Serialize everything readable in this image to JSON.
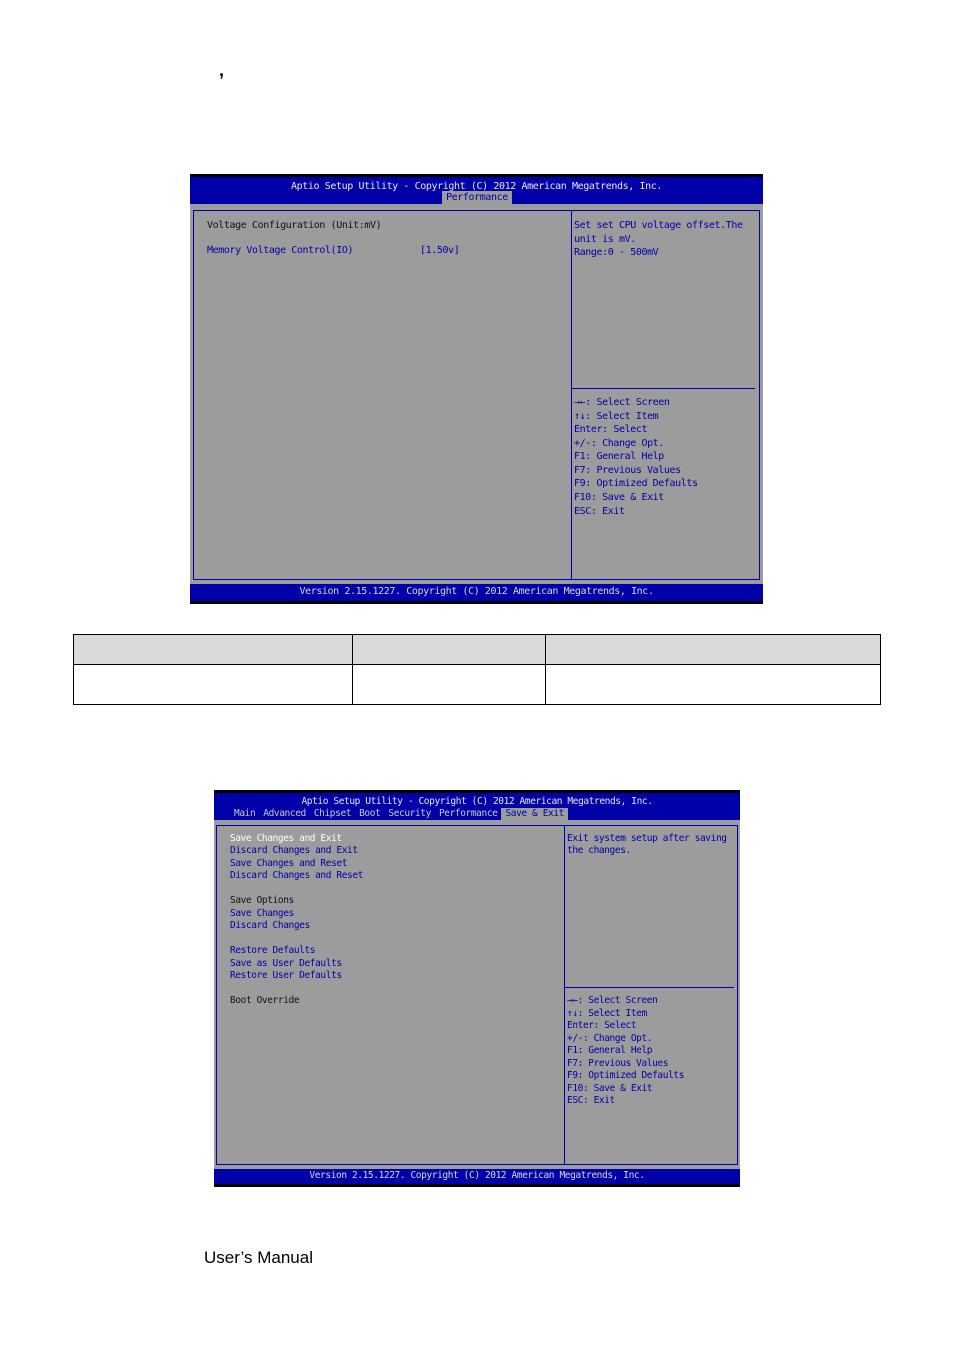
{
  "page": {
    "stray_mark": ",",
    "footer_text": "User’s Manual"
  },
  "bios_performance": {
    "title": "Aptio Setup Utility - Copyright (C) 2012 American Megatrends, Inc.",
    "tabs": [
      {
        "label": "Performance",
        "active": true
      }
    ],
    "section_heading": "Voltage Configuration (Unit:mV)",
    "items": [
      {
        "label": "Memory Voltage Control(IO)",
        "value": "[1.50v]"
      }
    ],
    "help_lines": [
      "Set set CPU voltage offset.The",
      "unit is mV.",
      "Range:0 - 500mV"
    ],
    "keys": [
      "→←: Select Screen",
      "↑↓: Select Item",
      "Enter: Select",
      "+/-: Change Opt.",
      "F1: General Help",
      "F7: Previous Values",
      "F9: Optimized Defaults",
      "F10: Save & Exit",
      "ESC: Exit"
    ],
    "version": "Version 2.15.1227. Copyright (C) 2012 American Megatrends, Inc."
  },
  "option_table": {
    "header": [
      "",
      "",
      ""
    ],
    "rows": [
      [
        "",
        "",
        ""
      ]
    ]
  },
  "bios_save_exit": {
    "title": "Aptio Setup Utility - Copyright (C) 2012 American Megatrends, Inc.",
    "tabs": [
      {
        "label": "Main",
        "active": false
      },
      {
        "label": "Advanced",
        "active": false
      },
      {
        "label": "Chipset",
        "active": false
      },
      {
        "label": "Boot",
        "active": false
      },
      {
        "label": "Security",
        "active": false
      },
      {
        "label": "Performance",
        "active": false
      },
      {
        "label": "Save & Exit",
        "active": true
      }
    ],
    "items": [
      {
        "label": "Save Changes and Exit",
        "kind": "selected"
      },
      {
        "label": "Discard Changes and Exit",
        "kind": "option"
      },
      {
        "label": "Save Changes and Reset",
        "kind": "option"
      },
      {
        "label": "Discard Changes and Reset",
        "kind": "option"
      },
      {
        "label": "Save Options",
        "kind": "heading"
      },
      {
        "label": "Save Changes",
        "kind": "option"
      },
      {
        "label": "Discard Changes",
        "kind": "option"
      },
      {
        "label": "Restore Defaults",
        "kind": "option"
      },
      {
        "label": "Save as User Defaults",
        "kind": "option"
      },
      {
        "label": "Restore User Defaults",
        "kind": "option"
      },
      {
        "label": "Boot Override",
        "kind": "heading"
      }
    ],
    "help_lines": [
      "Exit system setup after saving",
      "the changes."
    ],
    "keys": [
      "→←: Select Screen",
      "↑↓: Select Item",
      "Enter: Select",
      "+/-: Change Opt.",
      "F1: General Help",
      "F7: Previous Values",
      "F9: Optimized Defaults",
      "F10: Save & Exit",
      "ESC: Exit"
    ],
    "version": "Version 2.15.1227. Copyright (C) 2012 American Megatrends, Inc."
  },
  "colors": {
    "bios_blue": "#0000a8",
    "bios_gray": "#9c9c9c",
    "table_header": "#d9d9d9"
  }
}
